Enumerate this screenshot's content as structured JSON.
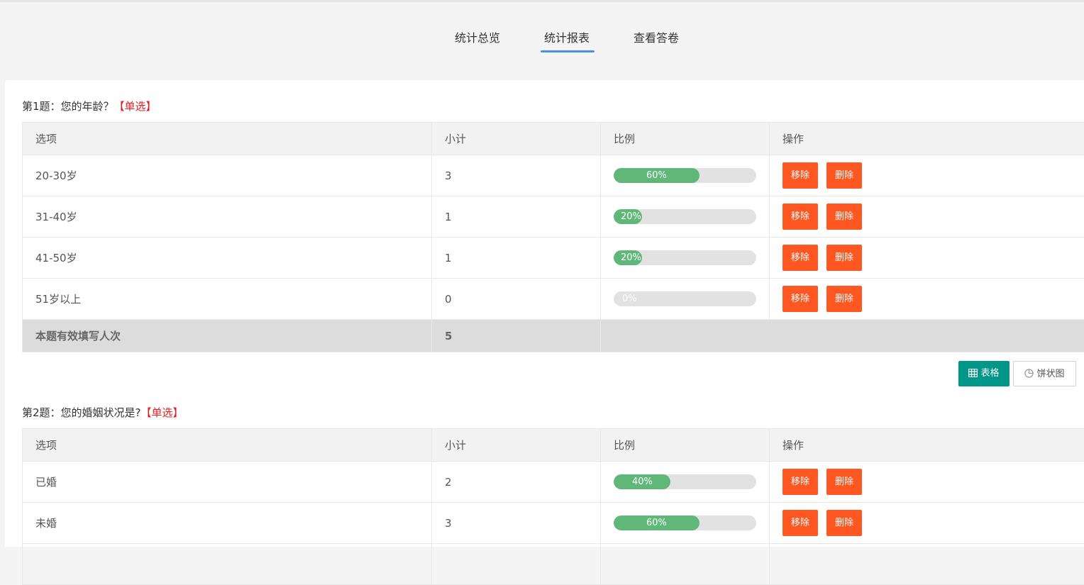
{
  "tabs": [
    {
      "label": "统计总览",
      "active": false
    },
    {
      "label": "统计报表",
      "active": true
    },
    {
      "label": "查看答卷",
      "active": false
    }
  ],
  "colors": {
    "accent": "#4a90e2",
    "bar_fill": "#5fb878",
    "danger": "#ff5722",
    "teal": "#009688",
    "qtype": "#e02020"
  },
  "table_headers": {
    "option": "选项",
    "count": "小计",
    "ratio": "比例",
    "action": "操作"
  },
  "actions": {
    "remove": "移除",
    "delete": "删除"
  },
  "view_switch": {
    "table_label": "表格",
    "table_icon": "table-icon",
    "pie_label": "饼状图",
    "pie_icon": "pie-chart-icon"
  },
  "questions": [
    {
      "title": "第1题：您的年龄？",
      "type": "【单选】",
      "rows": [
        {
          "option": "20-30岁",
          "count": "3",
          "percent": 60,
          "percent_label": "60%"
        },
        {
          "option": "31-40岁",
          "count": "1",
          "percent": 20,
          "percent_label": "20%"
        },
        {
          "option": "41-50岁",
          "count": "1",
          "percent": 20,
          "percent_label": "20%"
        },
        {
          "option": "51岁以上",
          "count": "0",
          "percent": 0,
          "percent_label": "0%"
        }
      ],
      "total_label": "本题有效填写人次",
      "total_value": "5"
    },
    {
      "title": "第2题：您的婚姻状况是?",
      "type": "【单选】",
      "rows": [
        {
          "option": "已婚",
          "count": "2",
          "percent": 40,
          "percent_label": "40%"
        },
        {
          "option": "未婚",
          "count": "3",
          "percent": 60,
          "percent_label": "60%"
        }
      ]
    }
  ]
}
